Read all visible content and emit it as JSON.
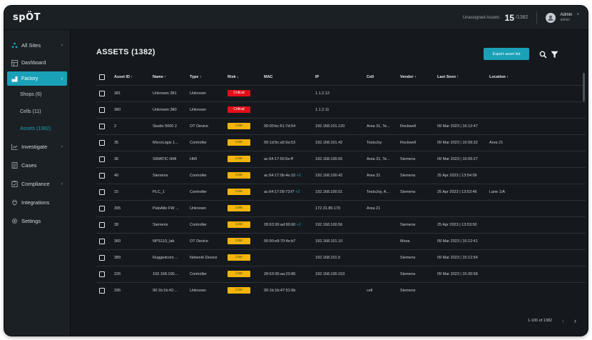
{
  "app": {
    "logo": "spÖT"
  },
  "topbar": {
    "unassigned_label": "Unassigned Assets:",
    "unassigned_count": "15",
    "unassigned_total": "/1382",
    "admin_name": "Admin",
    "admin_role": "admin",
    "caret": "˅"
  },
  "sidebar": {
    "all_sites": "All Sites",
    "dashboard": "Dashboard",
    "factory": "Factory",
    "shops": "Shops (6)",
    "cells": "Cells (11)",
    "assets": "Assets (1382)",
    "investigate": "Investigate",
    "cases": "Cases",
    "compliance": "Compliance",
    "integrations": "Integrations",
    "settings": "Settings",
    "chevron": "›"
  },
  "page": {
    "title": "ASSETS (1382)",
    "export_label": "Export asset list"
  },
  "table": {
    "headers": {
      "asset_id": "Asset ID ↑",
      "name": "Name ↑",
      "type": "Type ↑",
      "risk": "Risk ↓",
      "mac": "MAC",
      "ip": "IP",
      "cell": "Cell",
      "vendor": "Vendor ↑",
      "last_seen": "Last Seen ↑",
      "location": "Location ↑"
    },
    "rows": [
      {
        "id": "381",
        "name": "Unknown 381",
        "type": "Unknown",
        "risk": "Critical",
        "risk_level": "critical",
        "mac": "",
        "mac_extra": "",
        "ip": "1.1.2.12",
        "cell": "",
        "vendor": "",
        "last_seen": "",
        "location": ""
      },
      {
        "id": "380",
        "name": "Unknown 380",
        "type": "Unknown",
        "risk": "Critical",
        "risk_level": "critical",
        "mac": "",
        "mac_extra": "",
        "ip": "1.1.2.11",
        "cell": "",
        "vendor": "",
        "last_seen": "",
        "location": ""
      },
      {
        "id": "2",
        "name": "Studio 5000 2",
        "type": "OT Device",
        "risk": "Low",
        "risk_level": "low",
        "mac": "00:00:bc:61:7d:54",
        "mac_extra": "",
        "ip": "192.168.101.120",
        "cell": "Area 31, Te...",
        "vendor": "Rockwell",
        "last_seen": "09 Mar 2023 | 16:12:47",
        "location": ""
      },
      {
        "id": "35",
        "name": "MicroLogix 1...",
        "type": "Controller",
        "risk": "Low",
        "risk_level": "low",
        "mac": "00:1d:9c:a5:9a:53",
        "mac_extra": "",
        "ip": "192.168.101.42",
        "cell": "TestsJoy",
        "vendor": "Rockwell",
        "last_seen": "09 Mar 2023 | 16:09:32",
        "location": "Area 21"
      },
      {
        "id": "36",
        "name": "SIMATIC HMI",
        "type": "HMI",
        "risk": "Low",
        "risk_level": "low",
        "mac": "ac:64:17:50:5e:ff",
        "mac_extra": "",
        "ip": "192.168.100.55",
        "cell": "Area 31, Te...",
        "vendor": "Siemens",
        "last_seen": "09 Mar 2023 | 16:09:27",
        "location": ""
      },
      {
        "id": "40",
        "name": "Siemens",
        "type": "Controller",
        "risk": "Low",
        "risk_level": "low",
        "mac": "ac:64:17:0b:4e:10",
        "mac_extra": "+2",
        "ip": "192.168.100.42",
        "cell": "Area 31",
        "vendor": "Siemens",
        "last_seen": "25 Apr 2023 | 13:54:09",
        "location": ""
      },
      {
        "id": "15",
        "name": "PLC_1",
        "type": "Controller",
        "risk": "Low",
        "risk_level": "low",
        "mac": "ac:64:17:09:73:f7",
        "mac_extra": "+2",
        "ip": "192.168.100.51",
        "cell": "TestsJoy, A...",
        "vendor": "Siemens",
        "last_seen": "25 Apr 2023 | 13:53:46",
        "location": "Lane 1/A"
      },
      {
        "id": "395",
        "name": "PaloAlto FW ...",
        "type": "Unknown",
        "risk": "Low",
        "risk_level": "low",
        "mac": "",
        "mac_extra": "",
        "ip": "172.31.80.170",
        "cell": "Area 21",
        "vendor": "",
        "last_seen": "",
        "location": ""
      },
      {
        "id": "28",
        "name": "Siemens",
        "type": "Controller",
        "risk": "Low",
        "risk_level": "low",
        "mac": "28:63:36:ad:90:60",
        "mac_extra": "+1",
        "ip": "192.168.100.56",
        "cell": "",
        "vendor": "Siemens",
        "last_seen": "25 Apr 2023 | 13:53:50",
        "location": ""
      },
      {
        "id": "360",
        "name": "NPS110_lab",
        "type": "OT Device",
        "risk": "Low",
        "risk_level": "low",
        "mac": "00:90:e8:70:4e:b7",
        "mac_extra": "",
        "ip": "192.168.101.10",
        "cell": "",
        "vendor": "Moxa",
        "last_seen": "09 Mar 2023 | 16:12:41",
        "location": ""
      },
      {
        "id": "389",
        "name": "Ruggedcom ...",
        "type": "Network Device",
        "risk": "Low",
        "risk_level": "low",
        "mac": "",
        "mac_extra": "",
        "ip": "192.168.101.5",
        "cell": "",
        "vendor": "Siemens",
        "last_seen": "09 Mar 2023 | 15:12:54",
        "location": ""
      },
      {
        "id": "226",
        "name": "192.168.100....",
        "type": "Controller",
        "risk": "Low",
        "risk_level": "low",
        "mac": "28:63:36:aa:23:86",
        "mac_extra": "",
        "ip": "192.168.100.153",
        "cell": "",
        "vendor": "Siemens",
        "last_seen": "09 Mar 2023 | 15:30:58",
        "location": ""
      },
      {
        "id": "295",
        "name": "00:1b:1b:42:...",
        "type": "Unknown",
        "risk": "Low",
        "risk_level": "low",
        "mac": "00:1b:1b:47:51:6b",
        "mac_extra": "",
        "ip": "",
        "cell": "cell",
        "vendor": "Siemens",
        "last_seen": "",
        "location": ""
      }
    ]
  },
  "pagination": {
    "range": "1-100 of 1382",
    "prev": "‹",
    "next": "›"
  },
  "colors": {
    "accent": "#1aa1b8",
    "critical": "#e10f1a",
    "low": "#f2b50c",
    "background": "#15191d"
  }
}
